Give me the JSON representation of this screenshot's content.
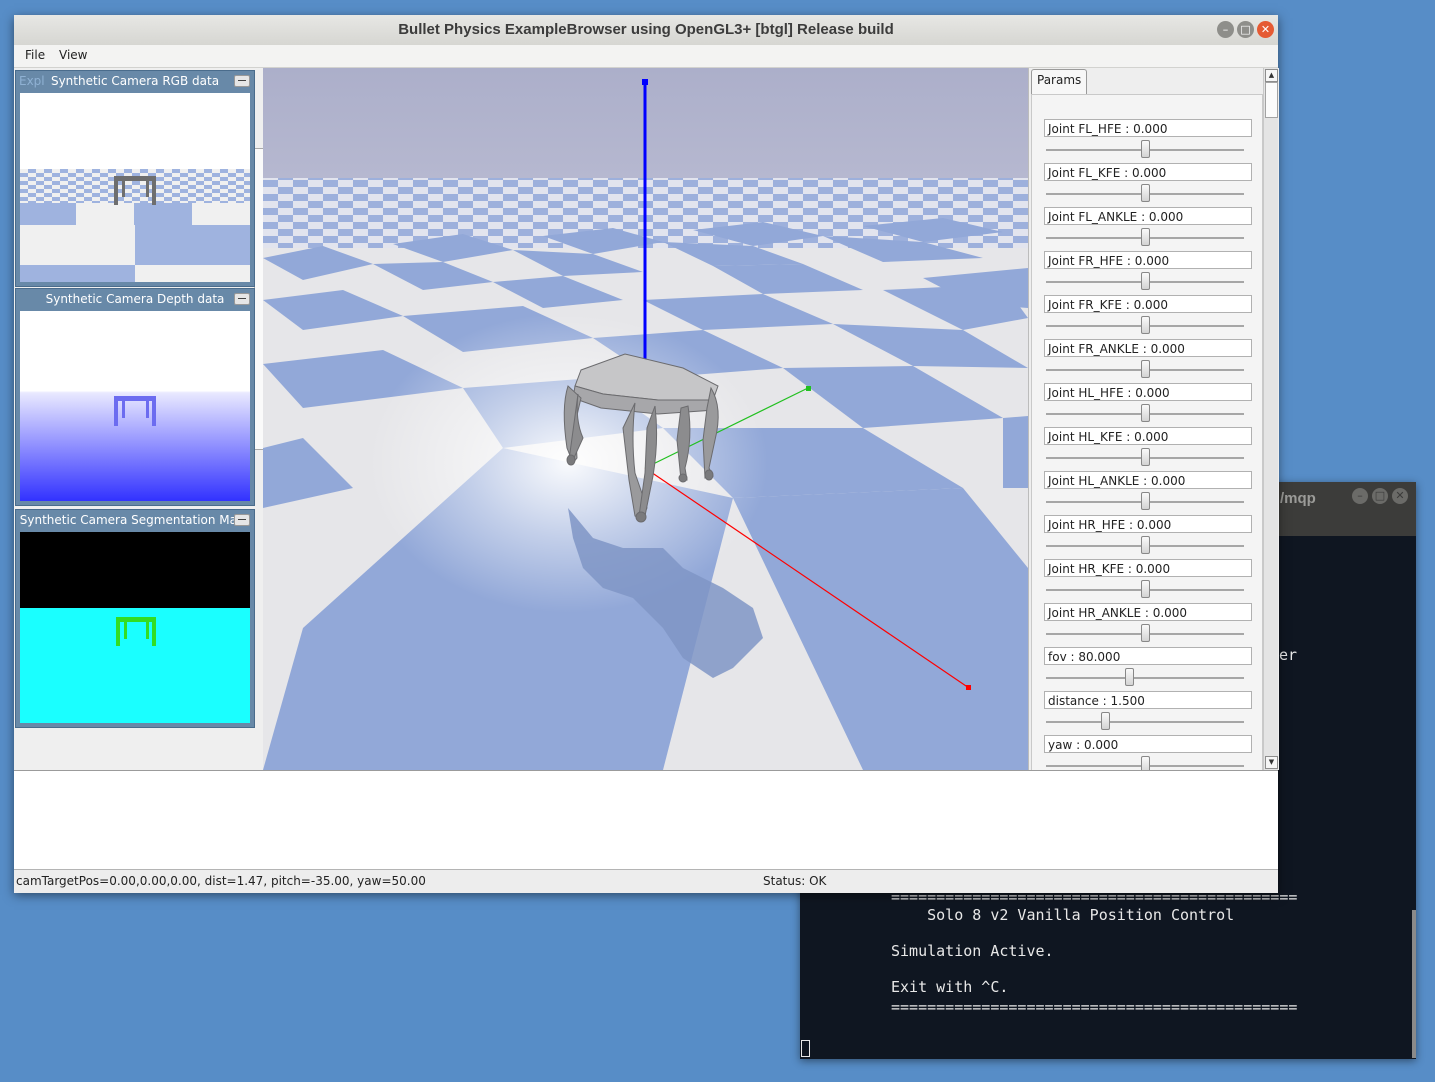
{
  "terminal": {
    "title_partial": "/mqp",
    "partial_line": "er",
    "rule": "=============================================",
    "heading": "    Solo 8 v2 Vanilla Position Control",
    "status_line": "Simulation Active.",
    "exit_line": "Exit with ^C."
  },
  "window": {
    "title": "Bullet Physics ExampleBrowser using OpenGL3+ [btgl] Release build"
  },
  "menu": {
    "file": "File",
    "view": "View"
  },
  "left_panel": {
    "hidden_label": "Expl",
    "cameras": [
      {
        "title": "Synthetic Camera RGB data"
      },
      {
        "title": "Synthetic Camera Depth data"
      },
      {
        "title": "Synthetic Camera Segmentation Mask"
      }
    ]
  },
  "params": {
    "tab": "Params",
    "sliders": [
      {
        "label": "Joint FL_HFE : 0.000",
        "level": 0.5
      },
      {
        "label": "Joint FL_KFE : 0.000",
        "level": 0.5
      },
      {
        "label": "Joint FL_ANKLE : 0.000",
        "level": 0.5
      },
      {
        "label": "Joint FR_HFE : 0.000",
        "level": 0.5
      },
      {
        "label": "Joint FR_KFE : 0.000",
        "level": 0.5
      },
      {
        "label": "Joint FR_ANKLE : 0.000",
        "level": 0.5
      },
      {
        "label": "Joint HL_HFE : 0.000",
        "level": 0.5
      },
      {
        "label": "Joint HL_KFE : 0.000",
        "level": 0.5
      },
      {
        "label": "Joint HL_ANKLE : 0.000",
        "level": 0.5
      },
      {
        "label": "Joint HR_HFE : 0.000",
        "level": 0.5
      },
      {
        "label": "Joint HR_KFE : 0.000",
        "level": 0.5
      },
      {
        "label": "Joint HR_ANKLE : 0.000",
        "level": 0.5
      },
      {
        "label": "fov : 80.000",
        "level": 0.42
      },
      {
        "label": "distance : 1.500",
        "level": 0.3
      },
      {
        "label": "yaw : 0.000",
        "level": 0.5
      }
    ]
  },
  "status": {
    "camera": "camTargetPos=0.00,0.00,0.00, dist=1.47, pitch=-35.00, yaw=50.00",
    "state": "Status: OK"
  },
  "colors": {
    "desktop": "#578dc7",
    "sky": "#b0b2ce",
    "floor_tile": "#92a8d8",
    "floor_light": "#ececec",
    "axis_z": "#0000ff",
    "axis_x": "#ff0000",
    "axis_y": "#00c000",
    "segmentation_background": "#000000",
    "segmentation_floor": "#1affff",
    "segmentation_robot": "#33dd22"
  }
}
